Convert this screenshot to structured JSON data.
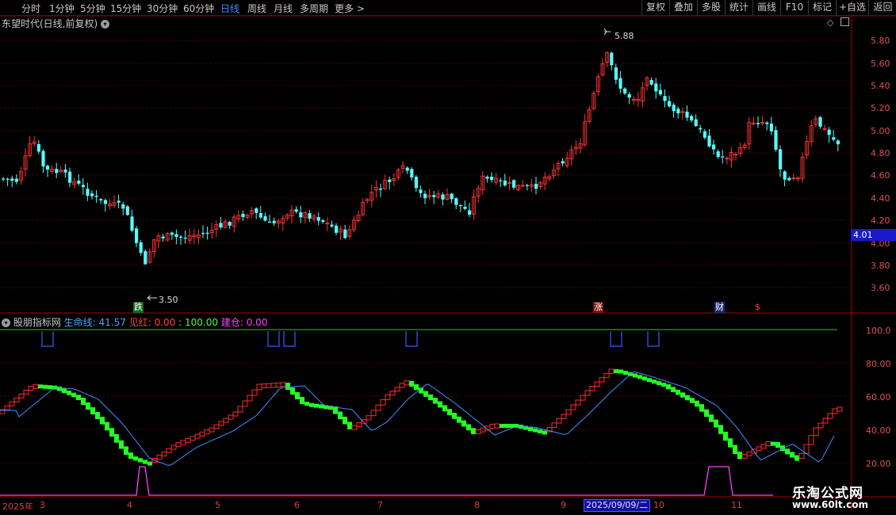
{
  "toolbar": {
    "periods": [
      "分时",
      "1分钟",
      "5分钟",
      "15分钟",
      "30分钟",
      "60分钟",
      "日线",
      "周线",
      "月线",
      "多周期",
      "更多 >"
    ],
    "active_period": "日线",
    "right_buttons": [
      "复权",
      "叠加",
      "多股",
      "统计",
      "画线",
      "F10",
      "标记",
      "+自选",
      "返回"
    ]
  },
  "chart": {
    "title": "东望时代(日线,前复权)",
    "price_axis": [
      "5.80",
      "5.60",
      "5.40",
      "5.20",
      "5.00",
      "4.80",
      "4.60",
      "4.40",
      "4.20",
      "4.00",
      "3.80",
      "3.60"
    ],
    "current_price": "4.01",
    "high_label": "5.88",
    "low_label": "3.50",
    "markers": {
      "fall": "跌",
      "rise": "涨",
      "finance": "财",
      "dollar": "$"
    },
    "colors": {
      "up": "#ff3333",
      "down": "#54ffff",
      "grid": "#5a0000"
    }
  },
  "indicator": {
    "name": "股朋指标网",
    "items": [
      {
        "label": "生命线:",
        "value": "41.57",
        "color": "#4aa8ff"
      },
      {
        "label": "见红:",
        "value": "0.00",
        "color": "#ff4040"
      },
      {
        "label": ":",
        "value": "100.00",
        "color": "#40ff40"
      },
      {
        "label": "建仓:",
        "value": "0.00",
        "color": "#ff40ff"
      }
    ],
    "axis": [
      "100.0",
      "80.00",
      "60.00",
      "40.00",
      "20.00"
    ]
  },
  "dates": {
    "labels": [
      "2025年",
      "3",
      "4",
      "5",
      "6",
      "7",
      "8",
      "9",
      "10",
      "11"
    ],
    "selected": "2025/09/09/二"
  },
  "watermark": {
    "line1": "乐淘公式网",
    "line2": "www.60lt.com"
  }
}
